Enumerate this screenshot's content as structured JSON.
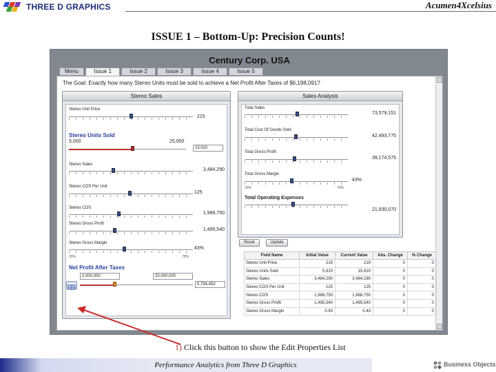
{
  "header": {
    "logo_text": "THREE D GRAPHICS",
    "brand": "Acumen4Xcelsius",
    "slide_title": "ISSUE 1 – Bottom-Up: Precision Counts!"
  },
  "app": {
    "company": "Century Corp. USA",
    "tabs": [
      "Menu",
      "Issue 1",
      "Issue 2",
      "Issue 3",
      "Issue 4",
      "Issue 5"
    ],
    "active_tab": "Issue 1",
    "goal_text": "The Goal: Exactly how many Stereo Units must be sold to achieve a Net Profit After Taxes of $6,198,091?",
    "stereo_sales_panel": {
      "title": "Stereo Sales",
      "unit_price_label": "Stereo Unit Price",
      "unit_price_value": "215",
      "units_sold_label": "Stereo Units Sold",
      "units_sold_min": "5,000",
      "units_sold_max": "25,000",
      "units_sold_value": "15,910",
      "sales_label": "Stereo Sales",
      "sales_value": "3,484,290",
      "cos_per_unit_label": "Stereo COS Per Unit",
      "cos_per_unit_value": "125",
      "cos_label": "Stereo COS",
      "cos_value": "1,988,750",
      "gross_profit_label": "Stereo Gross Profit",
      "gross_profit_value": "1,495,540",
      "gross_margin_label": "Stereo Gross Margin",
      "gross_margin_value": "43%",
      "gm_min": "20%",
      "gm_max": "70%",
      "npat_label": "Net Profit After Taxes",
      "npat_input_low": "2,000,000",
      "npat_input_high": "20,000,000",
      "npat_value": "5,794,450"
    },
    "sales_analysis_panel": {
      "title": "Sales Analysis",
      "total_sales_label": "Total Sales",
      "total_sales_value": "73,579,151",
      "total_cogs_label": "Total Cost Of Goods Sold",
      "total_cogs_value": "42,493,775",
      "total_gp_label": "Total Gross Profit",
      "total_gp_value": "39,174,575",
      "total_gm_label": "Total Gross Margin",
      "total_gm_value": "43%",
      "tgm_min": "20%",
      "tgm_max": "70%",
      "opex_label": "Total Operating Expenses",
      "opex_value": "21,930,070"
    },
    "buttons": {
      "reset": "Reset",
      "update": "Update"
    },
    "grid": {
      "headers": [
        "Field Name",
        "Initial Value",
        "Current Value",
        "Abs. Change",
        "% Change"
      ],
      "rows": [
        [
          "Stereo Unit Price",
          "219",
          "219",
          "0",
          "0"
        ],
        [
          "Stereo Units Sold",
          "5,910",
          "15,910",
          "0",
          "0"
        ],
        [
          "Stereo Sales",
          "3,484,290",
          "3,484,290",
          "0",
          "0"
        ],
        [
          "Stereo COS Per Unit",
          "125",
          "125",
          "0",
          "0"
        ],
        [
          "Stereo COS",
          "1,988,750",
          "1,988,750",
          "0",
          "0"
        ],
        [
          "Stereo Gross Profit",
          "1,495,540",
          "1,495,540",
          "0",
          "0"
        ],
        [
          "Stereo Gross Margin",
          "0.43",
          "0.43",
          "0",
          "0"
        ]
      ]
    }
  },
  "callout": {
    "number": "1)",
    "text": " Click this button to show the Edit Properties List"
  },
  "footer": {
    "text": "Performance Analytics from Three D Graphics",
    "partner_logo": "Business Objects"
  },
  "colors": {
    "accent": "#243d9c",
    "arrow": "#cc2a2a",
    "footer_band": "#1f2c8c"
  }
}
